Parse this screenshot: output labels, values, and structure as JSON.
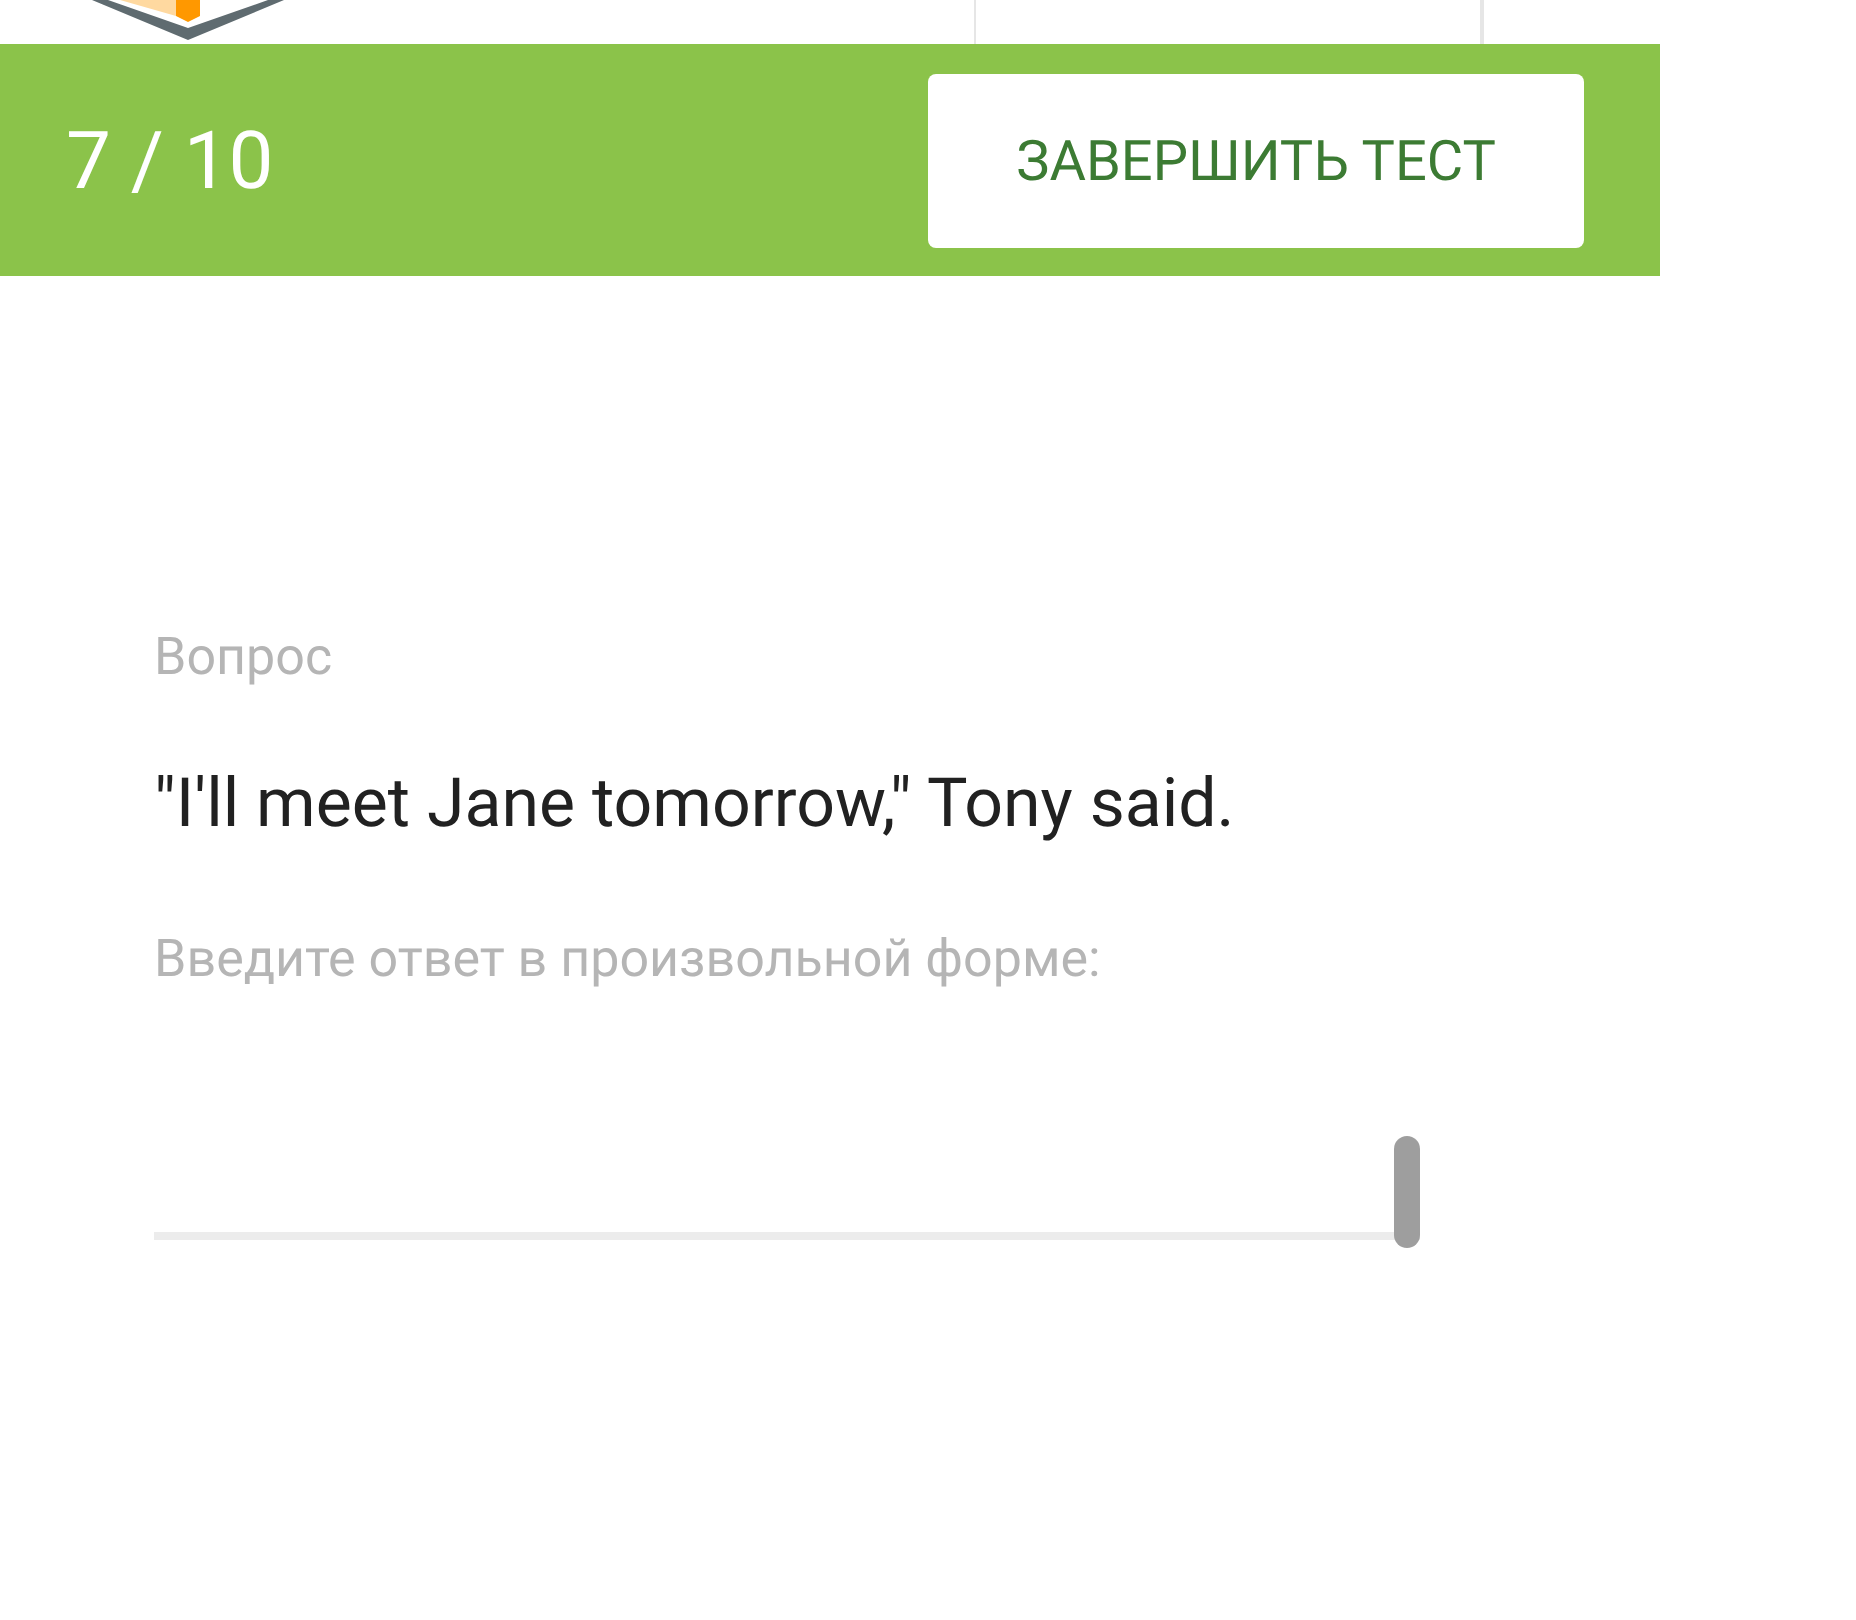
{
  "progress": "7 / 10",
  "finish_button": "ЗАВЕРШИТЬ ТЕСТ",
  "question_label": "Вопрос",
  "question": "\"I'll meet Jane tomorrow,\" Tony said.",
  "answer_hint": "Введите ответ в произвольной форме:"
}
